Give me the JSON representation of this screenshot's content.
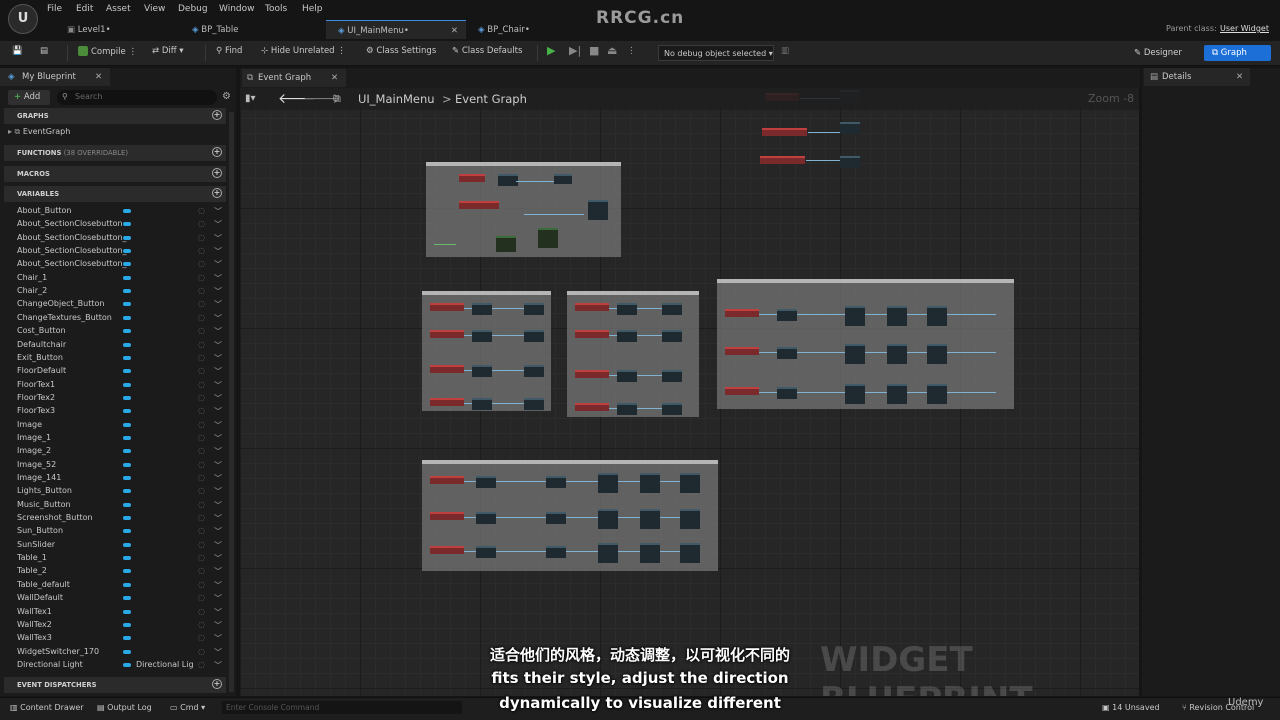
{
  "menu": [
    "File",
    "Edit",
    "Asset",
    "View",
    "Debug",
    "Window",
    "Tools",
    "Help"
  ],
  "doc_tabs": [
    "Level1•",
    "BP_Table",
    "UI_MainMenu•",
    "BP_Chair•"
  ],
  "watermark": "RRCG.cn",
  "parent_class_label": "Parent class:",
  "parent_class_value": "User Widget",
  "toolbar": {
    "compile": "Compile",
    "diff": "Diff",
    "find": "Find",
    "hide_unrelated": "Hide Unrelated",
    "class_settings": "Class Settings",
    "class_defaults": "Class Defaults",
    "debug_select": "No debug object selected",
    "designer": "Designer",
    "graph": "Graph"
  },
  "left": {
    "tab": "My Blueprint",
    "add": "Add",
    "search_placeholder": "Search",
    "graphs": "GRAPHS",
    "event_graph": "EventGraph",
    "functions": "FUNCTIONS",
    "functions_note": "(38 OVERRIDABLE)",
    "macros": "MACROS",
    "variables": "VARIABLES",
    "event_dispatchers": "EVENT DISPATCHERS",
    "vars": [
      "About_Button",
      "About_SectionClosebutton",
      "About_SectionClosebutton_",
      "About_SectionClosebutton_",
      "About_SectionClosebutton_",
      "Chair_1",
      "Chair_2",
      "ChangeObject_Button",
      "ChangeTextures_Button",
      "Cost_Button",
      "Defaultchair",
      "Exit_Button",
      "FloorDefault",
      "FloorTex1",
      "FloorTex2",
      "FloorTex3",
      "Image",
      "Image_1",
      "Image_2",
      "Image_52",
      "Image_141",
      "Lights_Button",
      "Music_Button",
      "Screenshot_Button",
      "Sun_Button",
      "SunSlider",
      "Table_1",
      "Table_2",
      "Table_default",
      "WallDefault",
      "WallTex1",
      "WallTex2",
      "WallTex3",
      "WidgetSwitcher_170"
    ],
    "last_var": "Directional Light",
    "last_var_type": "Directional Lig"
  },
  "graph": {
    "tab": "Event Graph",
    "breadcrumb_root": "UI_MainMenu",
    "breadcrumb_sep": ">",
    "breadcrumb_leaf": "Event Graph",
    "zoom": "Zoom -8",
    "bg_text": "WIDGET BLUEPRINT"
  },
  "right": {
    "tab": "Details"
  },
  "status": {
    "content_drawer": "Content Drawer",
    "output_log": "Output Log",
    "cmd": "Cmd",
    "console_placeholder": "Enter Console Command",
    "unsaved": "14 Unsaved",
    "revision": "Revision Control",
    "udemy": "Udemy"
  },
  "subtitles": {
    "zh": "适合他们的风格，动态调整，以可视化不同的",
    "en1": "fits their style, adjust the direction",
    "en2": "dynamically to visualize different"
  },
  "colors": {
    "accent": "#1b6fd6",
    "var_pill": "#2aa9e6",
    "exec_red": "#7a2a2a"
  }
}
